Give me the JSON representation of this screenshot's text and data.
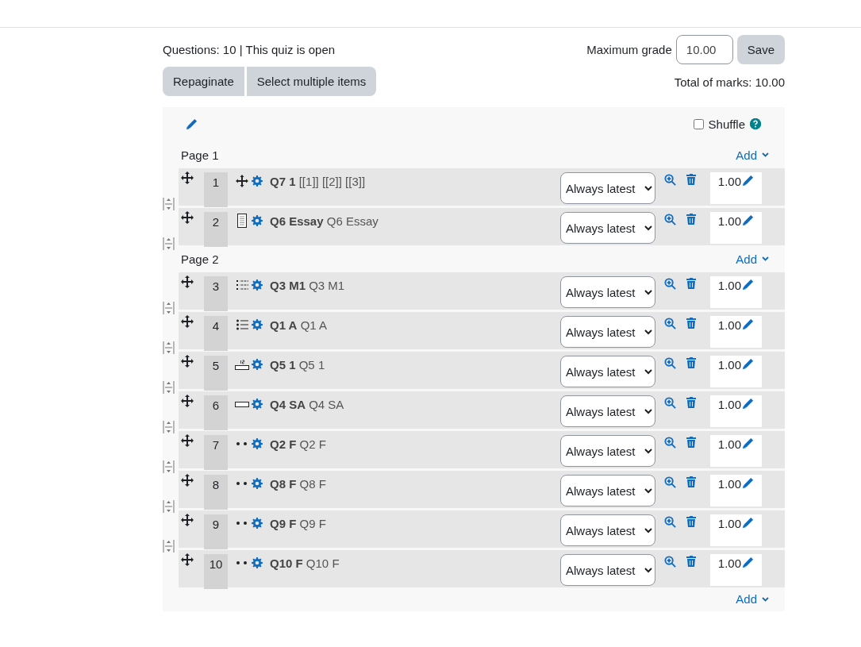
{
  "header": {
    "summary": "Questions: 10 | This quiz is open",
    "buttons": [
      "Repaginate",
      "Select multiple items"
    ],
    "max_grade": {
      "label": "Maximum grade",
      "value": "10.00"
    },
    "save": "Save",
    "total": "Total of marks: 10.00"
  },
  "section": {
    "shuffle": {
      "label": "Shuffle",
      "checked": false
    },
    "add": "Add",
    "pages": [
      {
        "title": "Page 1",
        "add": "Add",
        "questions": [
          {
            "number": "1",
            "kind": "multianswer",
            "name": "Q7 1",
            "text": "[[1]] [[2]] [[3]]",
            "version": "Always latest",
            "mark": "1.00"
          },
          {
            "number": "2",
            "kind": "essay",
            "name": "Q6 Essay",
            "text": "Q6 Essay",
            "version": "Always latest",
            "mark": "1.00"
          }
        ]
      },
      {
        "title": "Page 2",
        "add": "Add",
        "questions": [
          {
            "number": "3",
            "kind": "match",
            "name": "Q3 M1",
            "text": "Q3 M1",
            "version": "Always latest",
            "mark": "1.00"
          },
          {
            "number": "4",
            "kind": "multichoice",
            "name": "Q1 A",
            "text": "Q1 A",
            "version": "Always latest",
            "mark": "1.00"
          },
          {
            "number": "5",
            "kind": "numerical",
            "name": "Q5 1",
            "text": "Q5 1",
            "version": "Always latest",
            "mark": "1.00"
          },
          {
            "number": "6",
            "kind": "shortanswer",
            "name": "Q4 SA",
            "text": "Q4 SA",
            "version": "Always latest",
            "mark": "1.00"
          },
          {
            "number": "7",
            "kind": "dots",
            "name": "Q2 F",
            "text": "Q2 F",
            "version": "Always latest",
            "mark": "1.00"
          },
          {
            "number": "8",
            "kind": "dots",
            "name": "Q8 F",
            "text": "Q8 F",
            "version": "Always latest",
            "mark": "1.00"
          },
          {
            "number": "9",
            "kind": "dots",
            "name": "Q9 F",
            "text": "Q9 F",
            "version": "Always latest",
            "mark": "1.00"
          },
          {
            "number": "10",
            "kind": "dots",
            "name": "Q10 F",
            "text": "Q10 F",
            "version": "Always latest",
            "mark": "1.00"
          }
        ]
      }
    ]
  }
}
